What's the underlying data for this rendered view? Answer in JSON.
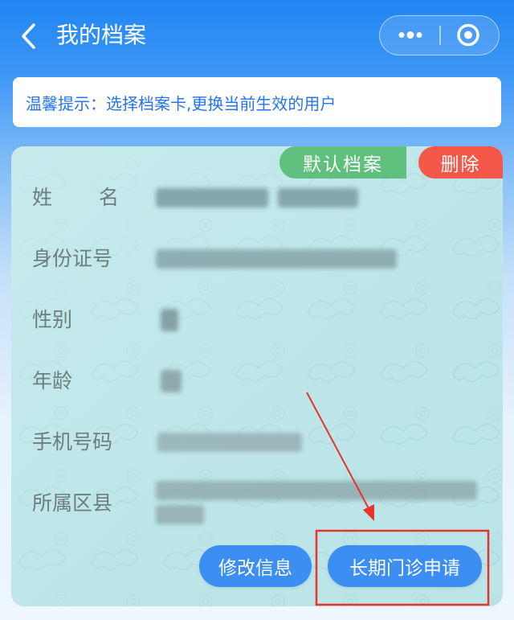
{
  "nav": {
    "title": "我的档案"
  },
  "tip": {
    "text": "温馨提示：选择档案卡,更换当前生效的用户"
  },
  "card": {
    "default_badge": "默认档案",
    "delete_badge": "删除",
    "fields": [
      {
        "label": "姓名"
      },
      {
        "label": "身份证号"
      },
      {
        "label": "性别"
      },
      {
        "label": "年龄"
      },
      {
        "label": "手机号码"
      },
      {
        "label": "所属区县"
      }
    ],
    "buttons": {
      "edit": "修改信息",
      "apply": "长期门诊申请"
    }
  },
  "colors": {
    "nav_blue": "#1f86f3",
    "tip_text": "#2574e8",
    "badge_green": "#5fbf7c",
    "badge_red": "#f4584a",
    "button_blue": "#3d8ef2",
    "annotation_red": "#e8332a"
  }
}
